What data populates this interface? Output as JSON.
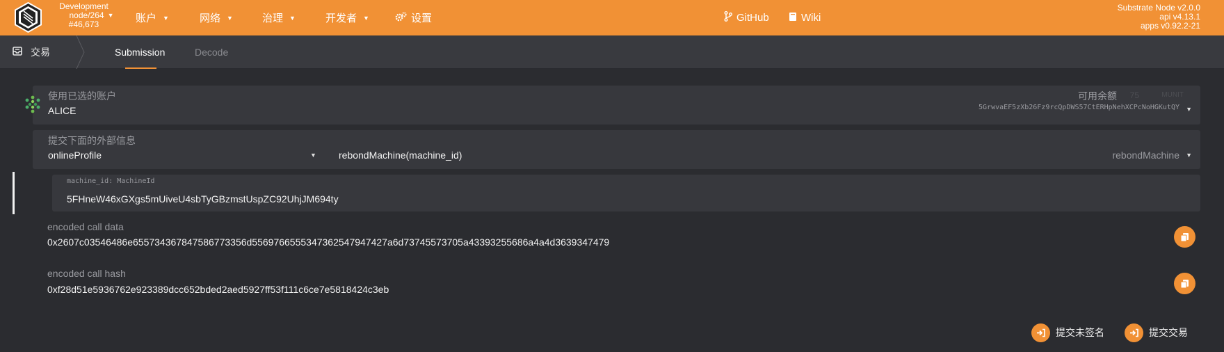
{
  "header": {
    "network": "Development",
    "node": "node/264",
    "block": "#46,673",
    "menu": {
      "accounts": "账户",
      "network": "网络",
      "governance": "治理",
      "developer": "开发者",
      "settings": "设置"
    },
    "links": {
      "github": "GitHub",
      "wiki": "Wiki"
    },
    "version": {
      "node": "Substrate Node v2.0.0",
      "api": "api v4.13.1",
      "apps": "apps v0.92.2-21"
    }
  },
  "subnav": {
    "section": "交易",
    "tabs": [
      {
        "label": "Submission",
        "active": true
      },
      {
        "label": "Decode",
        "active": false
      }
    ]
  },
  "account": {
    "label": "使用已选的账户",
    "name": "ALICE",
    "balance_label": "可用余额",
    "balance_value": "75",
    "balance_unit": "MUNIT",
    "address": "5GrwvaEF5zXb26Fz9rcQpDWS57CtERHpNehXCPcNoHGKutQY"
  },
  "extrinsic": {
    "label": "提交下面的外部信息",
    "module": "onlineProfile",
    "call": "rebondMachine(machine_id)",
    "method": "rebondMachine"
  },
  "param": {
    "label": "machine_id: MachineId",
    "value": "5FHneW46xGXgs5mUiveU4sbTyGBzmstUspZC92UhjJM694ty"
  },
  "encoded": {
    "data_label": "encoded call data",
    "data_value": "0x2607c03546486e65573436784758677335 6d556976655534736254794742 7a6d7374557370 5a43393255686a4a4d3639347479",
    "hash_label": "encoded call hash",
    "hash_value": "0xf28d51e5936762e923389dcc652bded2aed5927ff53f111c6ce7e5818424c3eb"
  },
  "actions": {
    "unsigned": "提交未签名",
    "submit": "提交交易"
  },
  "colors": {
    "accent": "#f19135",
    "background": "#2b2c30",
    "card": "#37383d"
  }
}
